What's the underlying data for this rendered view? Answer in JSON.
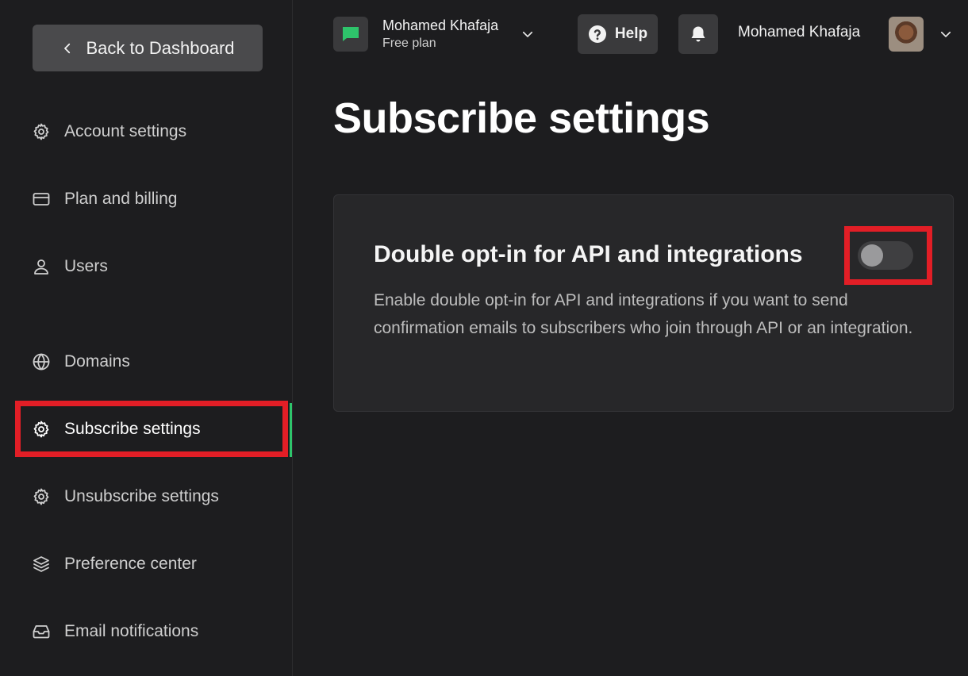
{
  "sidebar": {
    "back_label": "Back to Dashboard",
    "items": [
      {
        "label": "Account settings",
        "icon": "gear-icon"
      },
      {
        "label": "Plan and billing",
        "icon": "credit-card-icon"
      },
      {
        "label": "Users",
        "icon": "user-icon"
      },
      {
        "label": "Domains",
        "icon": "globe-icon"
      },
      {
        "label": "Subscribe settings",
        "icon": "gear-icon",
        "active": true
      },
      {
        "label": "Unsubscribe settings",
        "icon": "gear-icon"
      },
      {
        "label": "Preference center",
        "icon": "layers-icon"
      },
      {
        "label": "Email notifications",
        "icon": "inbox-icon"
      }
    ]
  },
  "header": {
    "account_name": "Mohamed Khafaja",
    "account_plan": "Free plan",
    "help_label": "Help",
    "user_name": "Mohamed Khafaja"
  },
  "main": {
    "title": "Subscribe settings",
    "card": {
      "title": "Double opt-in for API and integrations",
      "description": "Enable double opt-in for API and integrations if you want to send confirmation emails to subscribers who join through API or an integration.",
      "toggle_enabled": false
    }
  },
  "colors": {
    "accent": "#2ec46b",
    "highlight": "#e21e26",
    "background": "#1d1d1f",
    "card": "#272729"
  }
}
